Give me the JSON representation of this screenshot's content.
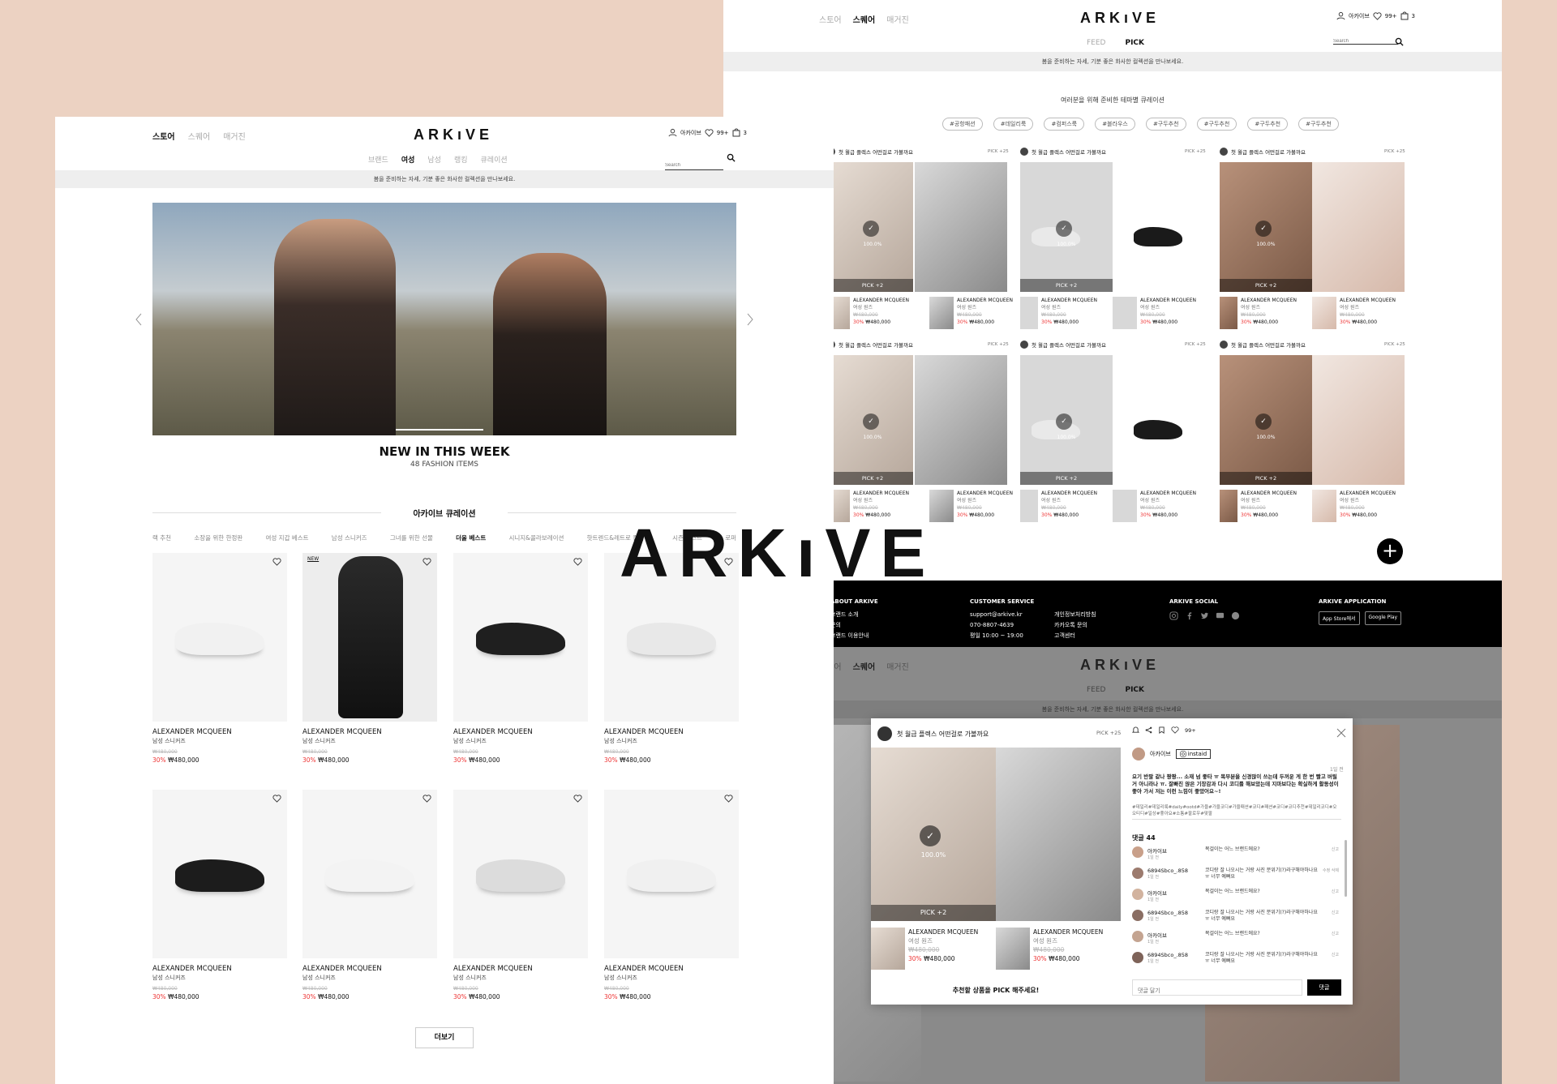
{
  "brand": {
    "logo": "ARKıVE",
    "big_logo": "ARKıVE"
  },
  "colors": {
    "accent_red": "#e33333",
    "background": "#ecd2c2",
    "footer_bg": "#000000"
  },
  "left": {
    "header": {
      "top_nav": [
        "스토어",
        "스퀘어",
        "매거진"
      ],
      "user": "아카이브",
      "wish_count": "99+",
      "cart_count": "3",
      "sub_nav": [
        "브랜드",
        "여성",
        "남성",
        "랭킹",
        "큐레이션"
      ],
      "search_placeholder": "Search"
    },
    "notice": "봄을 준비하는 자세, 기분 좋은 화사한 컬렉션을 만나보세요.",
    "hero": {
      "title": "NEW IN THIS WEEK",
      "subtitle": "48 FASHION ITEMS"
    },
    "curation": {
      "title": "아카이브 큐레이션",
      "tabs": [
        "랙 추천",
        "소장을 위한 한정판",
        "여성 지갑 베스트",
        "남성 스니커즈",
        "그녀를 위한 선물",
        "더울 베스트",
        "시니지&콜라보레이션",
        "핫트렌드&레트로 컬렉션",
        "시즌 베스트",
        "로퍼"
      ]
    },
    "products": [
      {
        "badge": "",
        "brand": "ALEXANDER MCQUEEN",
        "category": "남성 스니커즈",
        "original": "₩480,000",
        "discount": "30%",
        "price": "₩480,000"
      },
      {
        "badge": "NEW",
        "brand": "ALEXANDER MCQUEEN",
        "category": "남성 스니커즈",
        "original": "₩480,000",
        "discount": "30%",
        "price": "₩480,000"
      },
      {
        "badge": "",
        "brand": "ALEXANDER MCQUEEN",
        "category": "남성 스니커즈",
        "original": "₩480,000",
        "discount": "30%",
        "price": "₩480,000"
      },
      {
        "badge": "",
        "brand": "ALEXANDER MCQUEEN",
        "category": "남성 스니커즈",
        "original": "₩480,000",
        "discount": "30%",
        "price": "₩480,000"
      },
      {
        "badge": "",
        "brand": "ALEXANDER MCQUEEN",
        "category": "남성 스니커즈",
        "original": "₩480,000",
        "discount": "30%",
        "price": "₩480,000"
      },
      {
        "badge": "",
        "brand": "ALEXANDER MCQUEEN",
        "category": "남성 스니커즈",
        "original": "₩480,000",
        "discount": "30%",
        "price": "₩480,000"
      },
      {
        "badge": "",
        "brand": "ALEXANDER MCQUEEN",
        "category": "남성 스니커즈",
        "original": "₩480,000",
        "discount": "30%",
        "price": "₩480,000"
      },
      {
        "badge": "",
        "brand": "ALEXANDER MCQUEEN",
        "category": "남성 스니커즈",
        "original": "₩480,000",
        "discount": "30%",
        "price": "₩480,000"
      }
    ],
    "more_button": "더보기"
  },
  "right": {
    "header": {
      "top_nav": [
        "스토어",
        "스퀘어",
        "매거진"
      ],
      "user": "아카이브",
      "wish_count": "99+",
      "cart_count": "3",
      "sub_nav": [
        "FEED",
        "PICK"
      ],
      "search_placeholder": "Search"
    },
    "notice": "봄을 준비하는 자세, 기분 좋은 화사한 컬렉션을 만나보세요.",
    "theme_title": "여러분을 위해 준비한 테마별 큐레이션",
    "chips": [
      "#공항패션",
      "#데일리룩",
      "#컴퍼스룩",
      "#블라우스",
      "#구두추천",
      "#구두추천",
      "#구두추천",
      "#구두추천"
    ],
    "card": {
      "title": "첫 월급 플렉스 어떤걸로 가볼까요",
      "pick_count": "PICK +25",
      "percent": "100.0%",
      "pick_label": "PICK +2",
      "item_brand": "ALEXANDER MCQUEEN",
      "item_category": "여성 원즈",
      "item_original": "₩480,000",
      "item_discount": "30%",
      "item_price": "₩480,000"
    },
    "footer": {
      "about_title": "ABOUT ARKIVE",
      "about_items": [
        "브랜드 소개",
        "문의",
        "브랜드 이용안내"
      ],
      "cs_title": "CUSTOMER SERVICE",
      "cs_items": [
        "support@arkive.kr",
        "070-8807-4639",
        "평일 10:00 ~ 19:00"
      ],
      "cs_links": [
        "개인정보처리방침",
        "카카오톡 문의",
        "고객센터"
      ],
      "social_title": "ARKIVE SOCIAL",
      "app_title": "ARKIVE APPLICATION",
      "app_store": "App Store에서",
      "google_play": "Google Play"
    },
    "modal": {
      "title": "첫 월급 플렉스 어떤걸로 가볼까요",
      "pick_count": "PICK +25",
      "action_count": "99+",
      "user": "아카이브",
      "instaid": "instaid",
      "time": "1일 전",
      "caption": "요기 반팔 같나 짱짱... 소재 넘 좋타 ㅠ 목부분을 신경많이 쓰는데 두꺼운 게 한 번 빨고 버릴거 아니라나 ㅠ. 잘빠진 않은 기장감과 다시 코디를 해보았는데 지마보다는 확실하게 활동성이 좋아 가서 저는 이런 느낌이 좋았어요~!",
      "hashtags": "#데일리#데일리룩#daily#ootd#가을#가을코디#가을패션#코디#패션#코디#코디추천#데일리코디#오오티디#일상#좋아요#소통#팔로우#맞팔",
      "comments_label": "댓글 44",
      "comments": [
        {
          "user": "아카이브",
          "time": "1일 전",
          "text": "목걸이는 어느 브랜드에요?",
          "action": "신고"
        },
        {
          "user": "6894Sbco_.858",
          "time": "1일 전",
          "text": "코디랑 잘 나오시는 거랑 사진 분위기(?)라구해야하나요 ㅠ 너무 예뻐요",
          "action": "수정 삭제"
        },
        {
          "user": "아카이브",
          "time": "1일 전",
          "text": "목걸이는 어느 브랜드에요?",
          "action": "신고"
        },
        {
          "user": "6894Sbco_.858",
          "time": "1일 전",
          "text": "코디랑 잘 나오시는 거랑 사진 분위기(?)라구해야하나요 ㅠ 너무 예뻐요",
          "action": "신고"
        },
        {
          "user": "아카이브",
          "time": "1일 전",
          "text": "목걸이는 어느 브랜드에요?",
          "action": "신고"
        },
        {
          "user": "6894Sbco_.858",
          "time": "1일 전",
          "text": "코디랑 잘 나오시는 거랑 사진 분위기(?)라구해야하나요 ㅠ 너무 예뻐요",
          "action": "신고"
        }
      ],
      "comment_placeholder": "댓글 달기",
      "comment_button": "댓글",
      "percent": "100.0%",
      "pick_label": "PICK +2",
      "item_brand": "ALEXANDER MCQUEEN",
      "item_category": "여성 원즈",
      "item_original": "₩480,000",
      "item_discount": "30%",
      "item_price": "₩480,000",
      "recommend_text": "추천할 상품을 PICK 해주세요!"
    }
  }
}
